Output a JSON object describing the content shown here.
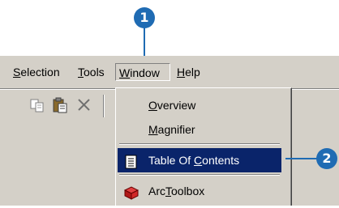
{
  "menubar": {
    "items": [
      {
        "label": "Selection",
        "accel": "S",
        "rest": "election"
      },
      {
        "label": "Tools",
        "accel": "T",
        "rest": "ools"
      },
      {
        "label": "Window",
        "accel": "W",
        "rest": "indow",
        "active": true
      },
      {
        "label": "Help",
        "accel": "H",
        "rest": "elp"
      }
    ]
  },
  "toolbar": {
    "icons": [
      "copy-icon",
      "paste-icon",
      "delete-icon"
    ]
  },
  "window_menu": {
    "items": [
      {
        "label": "Overview",
        "pre": "",
        "accel": "O",
        "post": "verview",
        "icon": ""
      },
      {
        "label": "Magnifier",
        "pre": "",
        "accel": "M",
        "post": "agnifier",
        "icon": ""
      },
      {
        "label": "Table Of Contents",
        "pre": "Table Of ",
        "accel": "C",
        "post": "ontents",
        "icon": "table-of-contents-icon",
        "selected": true
      },
      {
        "label": "ArcToolbox",
        "pre": "Arc",
        "accel": "T",
        "post": "oolbox",
        "icon": "arctoolbox-icon"
      }
    ]
  },
  "callouts": [
    {
      "number": "1"
    },
    {
      "number": "2"
    }
  ],
  "colors": {
    "chrome": "#d4d0c8",
    "highlight": "#0a246a",
    "callout": "#1f6bb3"
  }
}
